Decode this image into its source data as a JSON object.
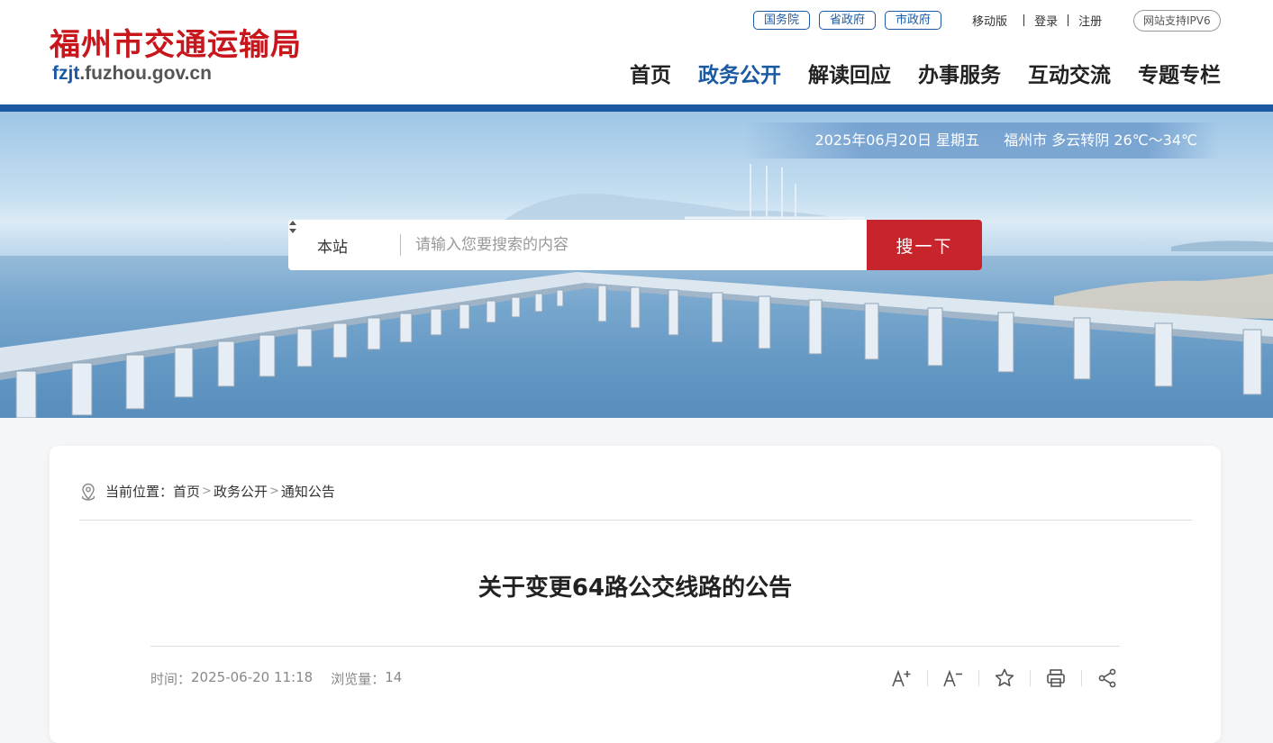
{
  "header": {
    "logo_title": "福州市交通运输局",
    "logo_domain_prefix": "fzjt",
    "logo_domain_rest": ".fuzhou.gov.cn",
    "gov_links": [
      "国务院",
      "省政府",
      "市政府"
    ],
    "mobile": "移动版",
    "login": "登录",
    "register": "注册",
    "ipv6": "网站支持IPV6",
    "nav": [
      "首页",
      "政务公开",
      "解读回应",
      "办事服务",
      "互动交流",
      "专题专栏"
    ],
    "nav_active_index": 1
  },
  "banner": {
    "date": "2025年06月20日 星期五",
    "weather": "福州市 多云转阴 26℃～34℃"
  },
  "search": {
    "scope": "本站",
    "placeholder": "请输入您要搜索的内容",
    "button": "搜一下"
  },
  "breadcrumb": {
    "label": "当前位置：",
    "items": [
      "首页",
      "政务公开",
      "通知公告"
    ]
  },
  "article": {
    "title": "关于变更64路公交线路的公告",
    "time_label": "时间：",
    "time": "2025-06-20 11:18",
    "views_label": "浏览量：",
    "views": "14"
  },
  "colors": {
    "brand_red": "#c8161d",
    "brand_blue": "#1b5aa3",
    "search_button": "#c7252b"
  },
  "icons": [
    "location-pin-icon",
    "font-increase-icon",
    "font-decrease-icon",
    "star-icon",
    "print-icon",
    "share-icon",
    "sort-arrows-icon"
  ]
}
